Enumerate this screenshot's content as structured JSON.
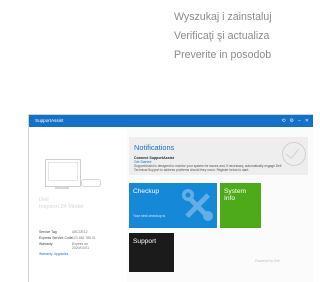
{
  "instructions": [
    "Wyszukaj i zainstaluj",
    "Verificaţi şi actualiza",
    "Preverite in posodob"
  ],
  "app": {
    "title": "SupportAssist",
    "icons": [
      "refresh-icon",
      "settings-icon",
      "minimize-icon",
      "close-icon"
    ]
  },
  "device": {
    "model_line1": "Dell",
    "model_line2": "Inspiron 24 Model",
    "service_tag_label": "Service Tag",
    "service_tag_value": "ABCDE12",
    "express_code_label": "Express Service Code",
    "express_code_value": "123 456 789 01",
    "warranty_label": "Warranty",
    "warranty_value_1": "Expires on",
    "warranty_value_2": "2020/01/01",
    "warranty_link": "Warranty Upgrades"
  },
  "notifications": {
    "title": "Notifications",
    "heading": "Connect SupportAssist",
    "link": "Get Started",
    "body": "SupportAssist is designed to monitor your system for issues and, if necessary, automatically engage Dell Technical Support to address problems should they occur. Register below to start."
  },
  "tiles": {
    "checkup": "Checkup",
    "checkup_sub": "Your next checkup is",
    "sysinfo_line1": "System",
    "sysinfo_line2": "Info",
    "support": "Support"
  },
  "footer": "Powered by Dell",
  "colors": {
    "titlebar": "#1272c9",
    "checkup": "#1688d8",
    "system_info": "#4faa1b",
    "support": "#1b1b1b"
  }
}
